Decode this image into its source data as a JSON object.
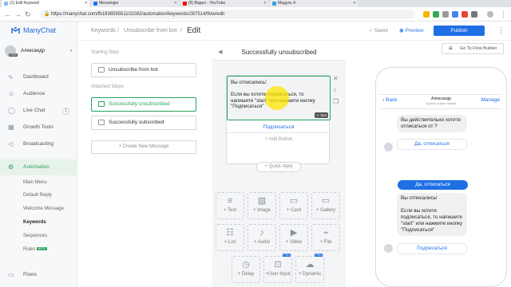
{
  "browser": {
    "tabs": [
      {
        "label": "(1) Edit Keyword"
      },
      {
        "label": "Messenger"
      },
      {
        "label": "(8) Видео - YouTube"
      },
      {
        "label": "Модуль 4"
      }
    ],
    "url": "https://manychat.com/fb193659551102282/automation/keywords/287514/flow/edit"
  },
  "sidebar": {
    "brand": "ManyChat",
    "account_name": "Александр",
    "account_badge": "FREE",
    "items": [
      {
        "label": "Dashboard",
        "icon": "pulse-icon"
      },
      {
        "label": "Audience",
        "icon": "user-icon"
      },
      {
        "label": "Live Chat",
        "icon": "chat-icon",
        "count": "1"
      },
      {
        "label": "Growth Tools",
        "icon": "growth-icon"
      },
      {
        "label": "Broadcasting",
        "icon": "broadcast-icon"
      },
      {
        "label": "Automation",
        "icon": "automation-icon"
      }
    ],
    "sub_items": [
      {
        "label": "Main Menu"
      },
      {
        "label": "Default Reply"
      },
      {
        "label": "Welcome Message"
      },
      {
        "label": "Keywords"
      },
      {
        "label": "Sequences"
      },
      {
        "label": "Rules",
        "badge": "BETA"
      }
    ],
    "flows": "Flows"
  },
  "header": {
    "crumb1": "Keywords",
    "crumb2": "Unsubscribe from bot",
    "crumb3": "Edit",
    "saved": "Saved",
    "preview": "Preview",
    "publish": "Publish",
    "flow_builder": "Go To Flow Builder"
  },
  "steps": {
    "starting_label": "Starting Step",
    "starting": "Unsubscribe from bot",
    "attached_label": "Attached Steps",
    "attached": [
      "Successfully unsubscribed",
      "Successfully subscribed"
    ],
    "create": "+ Create New Message"
  },
  "editor": {
    "title": "Successfully unsubscribed",
    "message_text": "Вы отписались!\n\nЕсли вы хотите подписаться, то напишите \"start\" или нажмите кнопку \"Подписаться\"",
    "char_count": "544",
    "button_label": "Подписаться",
    "add_button": "+ Add Button",
    "quick_reply": "+ Quick reply",
    "blocks": [
      {
        "label": "+ Text",
        "icon": "text-icon"
      },
      {
        "label": "+ Image",
        "icon": "image-icon"
      },
      {
        "label": "+ Card",
        "icon": "card-icon"
      },
      {
        "label": "+ Gallery",
        "icon": "gallery-icon"
      },
      {
        "label": "+ List",
        "icon": "list-icon"
      },
      {
        "label": "+ Audio",
        "icon": "audio-icon"
      },
      {
        "label": "+ Video",
        "icon": "video-icon"
      },
      {
        "label": "+ File",
        "icon": "file-icon"
      },
      {
        "label": "+ Delay",
        "icon": "clock-icon"
      },
      {
        "label": "+User Input",
        "icon": "user-input-icon",
        "badge": "PRO"
      },
      {
        "label": "+ Dynamic",
        "icon": "dynamic-icon",
        "badge": "PRO"
      }
    ]
  },
  "phone": {
    "back": "Back",
    "name": "Александр",
    "sub": "Typically replies instantly",
    "manage": "Manage",
    "bubble1": "Вы действительно хотите отписаться от ?",
    "button1": "Да, отписаться",
    "user_reply": "Да, отписаться",
    "bubble2": "Вы отписались!\n\nЕсли вы хотите подписаться, то напишите \"start\" или нажмите кнопку \"Подписаться\"",
    "button2": "Подписаться"
  }
}
